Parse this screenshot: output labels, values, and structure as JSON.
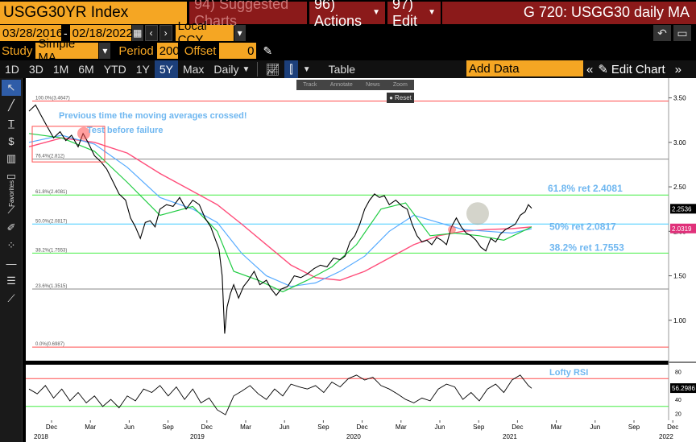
{
  "header": {
    "ticker": "USGG30YR Index",
    "suggested": "94) Suggested Charts",
    "actions": "96) Actions",
    "edit": "97) Edit",
    "chart_title": "G 720: USGG30 daily MA"
  },
  "range": {
    "start": "03/28/2016",
    "end": "02/18/2022",
    "currency": "Local CCY"
  },
  "study": {
    "label": "Study",
    "type": "Simple MA",
    "period_label": "Period",
    "period": "200",
    "offset_label": "Offset",
    "offset": "0"
  },
  "periods": [
    "1D",
    "3D",
    "1M",
    "6M",
    "YTD",
    "1Y",
    "5Y",
    "Max"
  ],
  "active_period": "5Y",
  "frequency": "Daily",
  "table_label": "Table",
  "add_data": "Add Data",
  "edit_chart": "Edit Chart",
  "float_tools": [
    "Track",
    "Annotate",
    "News",
    "Zoom"
  ],
  "reset_label": "Reset",
  "left_tools_caption": "Favorites",
  "colors": {
    "orange": "#f5a623",
    "red_menu": "#8b1a1a",
    "price": "#ffffff",
    "ma_short": "#22cc44",
    "ma_mid": "#55aaff",
    "ma_long": "#ff4d7a",
    "fib_100": "#ff4d4d",
    "fib_50": "#44ccff",
    "fib_382": "#44ee44",
    "annot": "#6fb7f0"
  },
  "annotations": {
    "crossed": "Previous time the moving averages crossed!",
    "test": "Test before failure",
    "fib618": "61.8% ret 2.4081",
    "fib50": "50% ret 2.0817",
    "fib382": "38.2% ret 1.7553",
    "rsi": "Lofty RSI"
  },
  "chart_data": {
    "type": "line",
    "fib_levels": [
      {
        "label": "100.0%(3.4647)",
        "value": 3.4647
      },
      {
        "label": "76.4%(2.812)",
        "value": 2.812
      },
      {
        "label": "61.8%(2.4081)",
        "value": 2.4081
      },
      {
        "label": "50.0%(2.0817)",
        "value": 2.0817
      },
      {
        "label": "38.2%(1.7553)",
        "value": 1.7553
      },
      {
        "label": "23.6%(1.3515)",
        "value": 1.3515
      },
      {
        "label": "0.0%(0.6987)",
        "value": 0.6987
      }
    ],
    "price_axis": {
      "ticks": [
        "3.50",
        "3.00",
        "2.50",
        "2.00",
        "1.50",
        "1.00"
      ],
      "ylim": [
        0.6,
        3.65
      ]
    },
    "price_tags": [
      {
        "label": "2.2536",
        "value": 2.2536
      },
      {
        "label": "2.0319",
        "value": 2.0319
      }
    ],
    "rsi_axis": {
      "ticks": [
        "80",
        "60",
        "40",
        "20"
      ],
      "levels": [
        70,
        30
      ],
      "ylim": [
        10,
        90
      ]
    },
    "rsi_tag": {
      "label": "56.2986",
      "value": 56.2986
    },
    "x_months": [
      "Dec",
      "Mar",
      "Jun",
      "Sep",
      "Dec",
      "Mar",
      "Jun",
      "Sep",
      "Dec",
      "Mar",
      "Jun",
      "Sep",
      "Dec",
      "Mar",
      "Jun",
      "Sep",
      "Dec"
    ],
    "x_years": [
      "2018",
      "2019",
      "2020",
      "2021",
      "2022"
    ],
    "price": [
      [
        0,
        3.35
      ],
      [
        8,
        3.42
      ],
      [
        15,
        3.3
      ],
      [
        22,
        3.18
      ],
      [
        30,
        3.05
      ],
      [
        38,
        3.12
      ],
      [
        45,
        3.02
      ],
      [
        52,
        3.08
      ],
      [
        60,
        2.95
      ],
      [
        66,
        3.1
      ],
      [
        72,
        3.0
      ],
      [
        80,
        2.85
      ],
      [
        88,
        2.78
      ],
      [
        95,
        2.7
      ],
      [
        103,
        2.55
      ],
      [
        110,
        2.42
      ],
      [
        118,
        2.35
      ],
      [
        124,
        2.15
      ],
      [
        130,
        2.05
      ],
      [
        136,
        1.92
      ],
      [
        142,
        2.1
      ],
      [
        148,
        2.12
      ],
      [
        154,
        2.05
      ],
      [
        160,
        2.25
      ],
      [
        168,
        2.3
      ],
      [
        176,
        2.28
      ],
      [
        184,
        2.38
      ],
      [
        192,
        2.25
      ],
      [
        200,
        2.35
      ],
      [
        208,
        2.3
      ],
      [
        215,
        2.15
      ],
      [
        222,
        2.05
      ],
      [
        228,
        1.9
      ],
      [
        232,
        1.8
      ],
      [
        236,
        1.5
      ],
      [
        239,
        0.85
      ],
      [
        242,
        1.15
      ],
      [
        246,
        1.3
      ],
      [
        250,
        1.4
      ],
      [
        256,
        1.25
      ],
      [
        262,
        1.38
      ],
      [
        268,
        1.45
      ],
      [
        275,
        1.55
      ],
      [
        282,
        1.4
      ],
      [
        290,
        1.45
      ],
      [
        296,
        1.35
      ],
      [
        302,
        1.28
      ],
      [
        308,
        1.35
      ],
      [
        316,
        1.38
      ],
      [
        324,
        1.5
      ],
      [
        332,
        1.48
      ],
      [
        340,
        1.52
      ],
      [
        348,
        1.58
      ],
      [
        356,
        1.62
      ],
      [
        364,
        1.6
      ],
      [
        372,
        1.7
      ],
      [
        380,
        1.68
      ],
      [
        386,
        1.72
      ],
      [
        392,
        1.88
      ],
      [
        398,
        1.95
      ],
      [
        404,
        2.08
      ],
      [
        410,
        2.25
      ],
      [
        416,
        2.35
      ],
      [
        422,
        2.42
      ],
      [
        428,
        2.38
      ],
      [
        434,
        2.4
      ],
      [
        440,
        2.3
      ],
      [
        448,
        2.35
      ],
      [
        456,
        2.28
      ],
      [
        462,
        2.25
      ],
      [
        468,
        2.08
      ],
      [
        474,
        1.95
      ],
      [
        480,
        1.88
      ],
      [
        486,
        1.9
      ],
      [
        492,
        1.85
      ],
      [
        498,
        1.93
      ],
      [
        504,
        1.9
      ],
      [
        510,
        1.85
      ],
      [
        516,
        2.05
      ],
      [
        522,
        2.15
      ],
      [
        528,
        2.05
      ],
      [
        534,
        1.98
      ],
      [
        540,
        1.95
      ],
      [
        546,
        1.9
      ],
      [
        552,
        1.82
      ],
      [
        558,
        1.78
      ],
      [
        564,
        1.92
      ],
      [
        570,
        1.88
      ],
      [
        576,
        1.97
      ],
      [
        582,
        2.02
      ],
      [
        588,
        2.05
      ],
      [
        594,
        2.08
      ],
      [
        600,
        2.18
      ],
      [
        606,
        2.22
      ],
      [
        610,
        2.3
      ],
      [
        614,
        2.26
      ]
    ],
    "ma_short": [
      [
        0,
        3.1
      ],
      [
        40,
        3.05
      ],
      [
        80,
        2.9
      ],
      [
        120,
        2.55
      ],
      [
        160,
        2.18
      ],
      [
        200,
        2.28
      ],
      [
        230,
        2.0
      ],
      [
        250,
        1.55
      ],
      [
        280,
        1.45
      ],
      [
        310,
        1.32
      ],
      [
        340,
        1.45
      ],
      [
        370,
        1.6
      ],
      [
        400,
        1.85
      ],
      [
        430,
        2.25
      ],
      [
        460,
        2.32
      ],
      [
        490,
        1.95
      ],
      [
        520,
        1.98
      ],
      [
        550,
        1.95
      ],
      [
        580,
        1.9
      ],
      [
        614,
        2.05
      ]
    ],
    "ma_mid": [
      [
        0,
        3.0
      ],
      [
        40,
        3.08
      ],
      [
        80,
        2.98
      ],
      [
        120,
        2.72
      ],
      [
        160,
        2.38
      ],
      [
        200,
        2.25
      ],
      [
        230,
        2.1
      ],
      [
        260,
        1.75
      ],
      [
        290,
        1.5
      ],
      [
        320,
        1.38
      ],
      [
        350,
        1.42
      ],
      [
        380,
        1.55
      ],
      [
        410,
        1.72
      ],
      [
        440,
        2.0
      ],
      [
        470,
        2.18
      ],
      [
        500,
        2.1
      ],
      [
        530,
        2.02
      ],
      [
        560,
        2.0
      ],
      [
        590,
        1.98
      ],
      [
        614,
        2.03
      ]
    ],
    "ma_long": [
      [
        0,
        2.95
      ],
      [
        40,
        3.05
      ],
      [
        80,
        3.0
      ],
      [
        120,
        2.88
      ],
      [
        160,
        2.65
      ],
      [
        200,
        2.45
      ],
      [
        230,
        2.3
      ],
      [
        260,
        2.08
      ],
      [
        290,
        1.85
      ],
      [
        320,
        1.62
      ],
      [
        350,
        1.48
      ],
      [
        380,
        1.45
      ],
      [
        410,
        1.55
      ],
      [
        440,
        1.7
      ],
      [
        470,
        1.85
      ],
      [
        500,
        1.95
      ],
      [
        530,
        2.0
      ],
      [
        560,
        2.02
      ],
      [
        590,
        2.03
      ],
      [
        614,
        2.05
      ]
    ],
    "rsi": [
      [
        0,
        55
      ],
      [
        10,
        48
      ],
      [
        20,
        60
      ],
      [
        30,
        42
      ],
      [
        40,
        55
      ],
      [
        50,
        38
      ],
      [
        60,
        50
      ],
      [
        70,
        35
      ],
      [
        80,
        45
      ],
      [
        90,
        30
      ],
      [
        100,
        40
      ],
      [
        110,
        28
      ],
      [
        120,
        45
      ],
      [
        130,
        38
      ],
      [
        140,
        55
      ],
      [
        150,
        50
      ],
      [
        160,
        60
      ],
      [
        170,
        45
      ],
      [
        180,
        58
      ],
      [
        190,
        40
      ],
      [
        200,
        55
      ],
      [
        210,
        35
      ],
      [
        220,
        42
      ],
      [
        230,
        25
      ],
      [
        240,
        18
      ],
      [
        250,
        45
      ],
      [
        260,
        52
      ],
      [
        270,
        60
      ],
      [
        280,
        48
      ],
      [
        290,
        40
      ],
      [
        300,
        55
      ],
      [
        310,
        45
      ],
      [
        320,
        62
      ],
      [
        330,
        58
      ],
      [
        340,
        55
      ],
      [
        350,
        60
      ],
      [
        360,
        50
      ],
      [
        370,
        65
      ],
      [
        380,
        58
      ],
      [
        390,
        70
      ],
      [
        400,
        75
      ],
      [
        410,
        68
      ],
      [
        420,
        72
      ],
      [
        430,
        60
      ],
      [
        440,
        55
      ],
      [
        450,
        48
      ],
      [
        460,
        40
      ],
      [
        470,
        35
      ],
      [
        480,
        42
      ],
      [
        490,
        38
      ],
      [
        500,
        55
      ],
      [
        510,
        62
      ],
      [
        520,
        58
      ],
      [
        530,
        40
      ],
      [
        540,
        50
      ],
      [
        550,
        38
      ],
      [
        560,
        55
      ],
      [
        570,
        62
      ],
      [
        580,
        50
      ],
      [
        590,
        68
      ],
      [
        600,
        75
      ],
      [
        610,
        60
      ],
      [
        614,
        56
      ]
    ]
  }
}
